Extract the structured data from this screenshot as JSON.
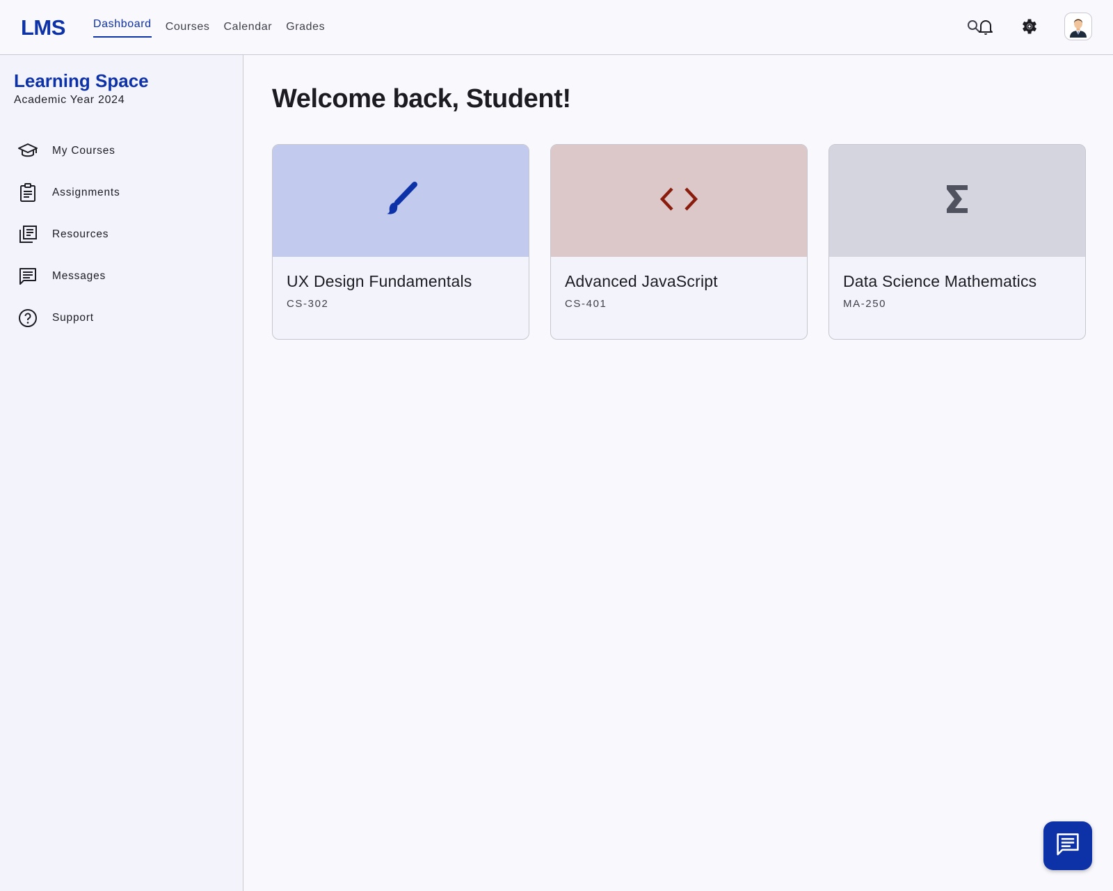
{
  "app": {
    "logo": "LMS"
  },
  "nav": {
    "items": [
      {
        "label": "Dashboard",
        "active": true
      },
      {
        "label": "Courses",
        "active": false
      },
      {
        "label": "Calendar",
        "active": false
      },
      {
        "label": "Grades",
        "active": false
      }
    ]
  },
  "top_icons": [
    "search-icon",
    "bell-icon",
    "gear-icon",
    "avatar"
  ],
  "sidebar": {
    "title": "Learning Space",
    "subtitle": "Academic Year 2024",
    "items": [
      {
        "label": "My Courses",
        "icon": "graduation-cap-icon"
      },
      {
        "label": "Assignments",
        "icon": "clipboard-icon"
      },
      {
        "label": "Resources",
        "icon": "library-icon"
      },
      {
        "label": "Messages",
        "icon": "message-icon"
      },
      {
        "label": "Support",
        "icon": "help-circle-icon"
      }
    ]
  },
  "main": {
    "welcome": "Welcome back, Student!",
    "courses": [
      {
        "title": "UX Design Fundamentals",
        "code": "CS-302",
        "icon": "brush-icon",
        "banner_color": "#c2cbee",
        "icon_color": "#0d32a7"
      },
      {
        "title": "Advanced JavaScript",
        "code": "CS-401",
        "icon": "code-icon",
        "banner_color": "#dcc8c9",
        "icon_color": "#8a1c0e"
      },
      {
        "title": "Data Science Mathematics",
        "code": "MA-250",
        "icon": "sigma-icon",
        "banner_color": "#d5d5df",
        "icon_color": "#50535f"
      }
    ]
  },
  "fab": {
    "icon": "chat-icon"
  },
  "colors": {
    "primary": "#0d32a7",
    "background": "#f8f8fd",
    "sidebar": "#f3f3fc",
    "border": "#c9c9d4"
  }
}
